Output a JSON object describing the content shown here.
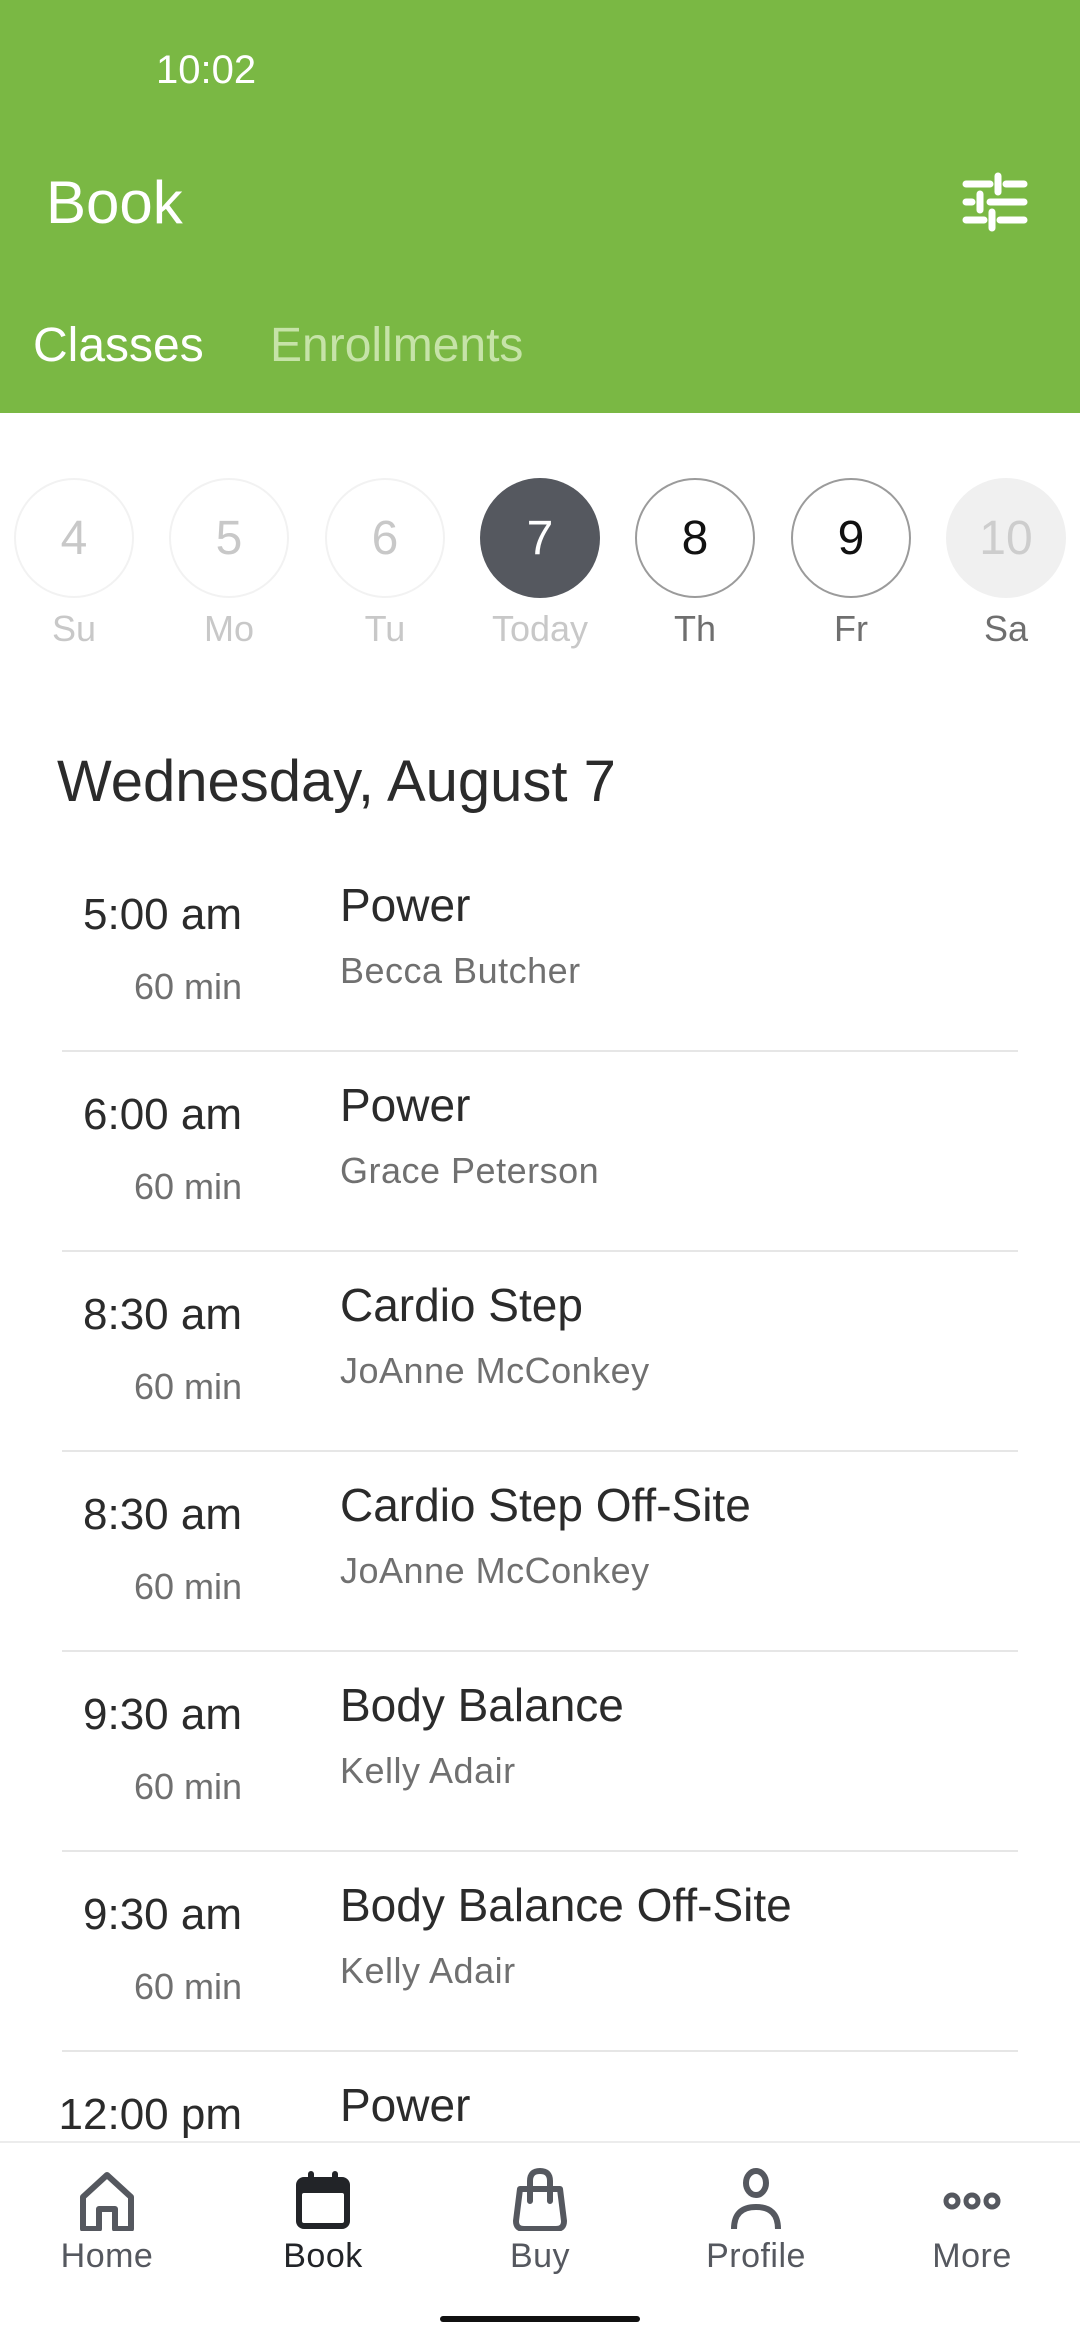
{
  "status_bar": {
    "time": "10:02"
  },
  "header": {
    "title": "Book",
    "filter_icon": "sliders-icon",
    "background_color": "#7ab844"
  },
  "tabs": [
    {
      "label": "Classes",
      "active": true
    },
    {
      "label": "Enrollments",
      "active": false
    }
  ],
  "date_strip": [
    {
      "day_number": "4",
      "day_label": "Su",
      "state": "past"
    },
    {
      "day_number": "5",
      "day_label": "Mo",
      "state": "past"
    },
    {
      "day_number": "6",
      "day_label": "Tu",
      "state": "past"
    },
    {
      "day_number": "7",
      "day_label": "Today",
      "state": "selected"
    },
    {
      "day_number": "8",
      "day_label": "Th",
      "state": "future"
    },
    {
      "day_number": "9",
      "day_label": "Fr",
      "state": "future"
    },
    {
      "day_number": "10",
      "day_label": "Sa",
      "state": "disabled"
    }
  ],
  "schedule": {
    "date_heading": "Wednesday, August 7",
    "classes": [
      {
        "time": "5:00 am",
        "duration": "60 min",
        "name": "Power",
        "instructor": "Becca Butcher"
      },
      {
        "time": "6:00 am",
        "duration": "60 min",
        "name": "Power",
        "instructor": "Grace Peterson"
      },
      {
        "time": "8:30 am",
        "duration": "60 min",
        "name": "Cardio Step",
        "instructor": "JoAnne McConkey"
      },
      {
        "time": "8:30 am",
        "duration": "60 min",
        "name": "Cardio Step Off-Site",
        "instructor": "JoAnne McConkey"
      },
      {
        "time": "9:30 am",
        "duration": "60 min",
        "name": "Body Balance",
        "instructor": "Kelly Adair"
      },
      {
        "time": "9:30 am",
        "duration": "60 min",
        "name": "Body Balance Off-Site",
        "instructor": "Kelly Adair"
      },
      {
        "time": "12:00 pm",
        "duration": "",
        "name": "Power",
        "instructor": ""
      }
    ]
  },
  "bottom_nav": [
    {
      "label": "Home",
      "icon": "home-icon",
      "active": false
    },
    {
      "label": "Book",
      "icon": "calendar-icon",
      "active": true
    },
    {
      "label": "Buy",
      "icon": "shopping-bag-icon",
      "active": false
    },
    {
      "label": "Profile",
      "icon": "person-icon",
      "active": false
    },
    {
      "label": "More",
      "icon": "more-dots-icon",
      "active": false
    }
  ]
}
